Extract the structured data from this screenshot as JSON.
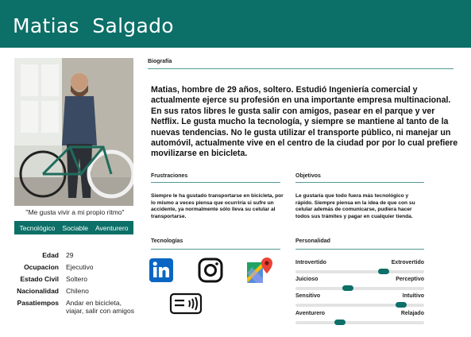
{
  "header": {
    "title": "Matias  Salgado"
  },
  "profile": {
    "quote": "\"Me gusta vivir a mi propio ritmo\"",
    "tags": [
      "Tecnológico",
      "Sociable",
      "Aventurero"
    ],
    "facts": [
      {
        "key": "Edad",
        "value": "29"
      },
      {
        "key": "Ocupacion",
        "value": "Ejecutivo"
      },
      {
        "key": "Estado Civil",
        "value": "Soltero"
      },
      {
        "key": "Nacionalidad",
        "value": "Chileno"
      },
      {
        "key": "Pasatiempos",
        "value": "Andar en bicicleta, viajar, salir con amigos"
      }
    ]
  },
  "biografia": {
    "title": "Biografía",
    "text": "Matias, hombre de 29 años, soltero. Estudió Ingeniería comercial y actualmente ejerce su profesión en una importante empresa multinacional. En sus ratos libres le gusta salir con amigos, pasear en el parque y ver Netflix. Le gusta mucho la tecnología, y siempre se mantiene al tanto de la nuevas tendencias. No le gusta utilizar el transporte público, ni manejar un automóvil, actualmente vive en el centro de la ciudad por por lo cual prefiere movilizarse en bicicleta."
  },
  "frustraciones": {
    "title": "Frustraciones",
    "text": "Siempre le ha gustado transportarse en bicicleta, por lo mismo a veces piensa que ocurriría si sufre un accidente, ya normalmente sólo lleva su celular al transportarse."
  },
  "objetivos": {
    "title": "Objetivos",
    "text": "Le gustaría que todo fuera más tecnológico y rápido. Siempre piensa en la idea de que con su celular además de comunicarse, pudiera hacer todos sus trámites y pagar en cualquier tienda."
  },
  "tecnologias": {
    "title": "Tecnologías",
    "icons": [
      "linkedin-icon",
      "instagram-icon",
      "google-maps-icon",
      "contactless-payment-icon"
    ],
    "colors": {
      "linkedin": "#0a66c2"
    }
  },
  "personalidad": {
    "title": "Personalidad",
    "traits": [
      {
        "left": "Introvertido",
        "right": "Extrovertido",
        "level": 0.7
      },
      {
        "left": "Juicioso",
        "right": "Perceptivo",
        "level": 0.4
      },
      {
        "left": "Sensitivo",
        "right": "Intuitivo",
        "level": 0.85
      },
      {
        "left": "Aventurero",
        "right": "Relajado",
        "level": 0.33
      }
    ]
  },
  "colors": {
    "accent": "#0c6f68"
  }
}
